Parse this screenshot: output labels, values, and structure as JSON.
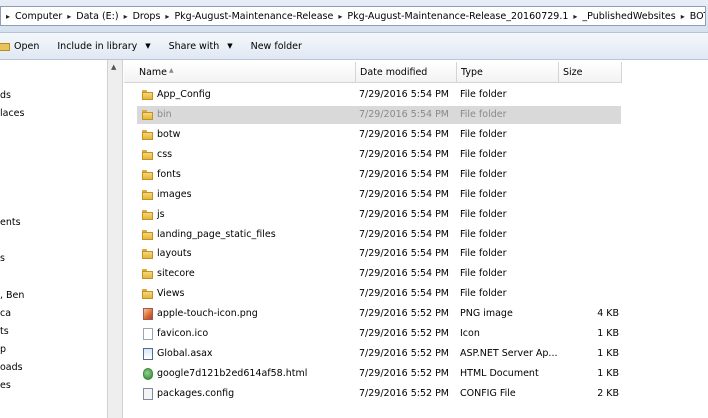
{
  "address_bar": {
    "breadcrumbs": [
      "Computer",
      "Data (E:)",
      "Drops",
      "Pkg-August-Maintenance-Release",
      "Pkg-August-Maintenance-Release_20160729.1",
      "_PublishedWebsites",
      "BOTWSitecoreWeb"
    ]
  },
  "toolbar": {
    "open_label": "Open",
    "include_label": "Include in library",
    "share_label": "Share with",
    "new_folder_label": "New folder"
  },
  "nav_pane": {
    "items": [
      "ds",
      "laces",
      "ents",
      "s",
      ", Ben",
      "ca",
      "ts",
      "p",
      "oads",
      "es"
    ]
  },
  "columns": {
    "name": "Name",
    "date": "Date modified",
    "type": "Type",
    "size": "Size"
  },
  "files": [
    {
      "name": "App_Config",
      "date": "7/29/2016 5:54 PM",
      "type": "File folder",
      "size": "",
      "icon": "folder-icon"
    },
    {
      "name": "bin",
      "date": "7/29/2016 5:54 PM",
      "type": "File folder",
      "size": "",
      "icon": "folder-icon",
      "selected": true
    },
    {
      "name": "botw",
      "date": "7/29/2016 5:54 PM",
      "type": "File folder",
      "size": "",
      "icon": "folder-icon"
    },
    {
      "name": "css",
      "date": "7/29/2016 5:54 PM",
      "type": "File folder",
      "size": "",
      "icon": "folder-icon"
    },
    {
      "name": "fonts",
      "date": "7/29/2016 5:54 PM",
      "type": "File folder",
      "size": "",
      "icon": "folder-icon"
    },
    {
      "name": "images",
      "date": "7/29/2016 5:54 PM",
      "type": "File folder",
      "size": "",
      "icon": "folder-icon"
    },
    {
      "name": "js",
      "date": "7/29/2016 5:54 PM",
      "type": "File folder",
      "size": "",
      "icon": "folder-icon"
    },
    {
      "name": "landing_page_static_files",
      "date": "7/29/2016 5:54 PM",
      "type": "File folder",
      "size": "",
      "icon": "folder-icon"
    },
    {
      "name": "layouts",
      "date": "7/29/2016 5:54 PM",
      "type": "File folder",
      "size": "",
      "icon": "folder-icon"
    },
    {
      "name": "sitecore",
      "date": "7/29/2016 5:54 PM",
      "type": "File folder",
      "size": "",
      "icon": "folder-icon"
    },
    {
      "name": "Views",
      "date": "7/29/2016 5:54 PM",
      "type": "File folder",
      "size": "",
      "icon": "folder-icon"
    },
    {
      "name": "apple-touch-icon.png",
      "date": "7/29/2016 5:52 PM",
      "type": "PNG image",
      "size": "4 KB",
      "icon": "png-file-icon"
    },
    {
      "name": "favicon.ico",
      "date": "7/29/2016 5:52 PM",
      "type": "Icon",
      "size": "1 KB",
      "icon": "ico-file-icon"
    },
    {
      "name": "Global.asax",
      "date": "7/29/2016 5:52 PM",
      "type": "ASP.NET Server Ap...",
      "size": "1 KB",
      "icon": "asax-file-icon"
    },
    {
      "name": "google7d121b2ed614af58.html",
      "date": "7/29/2016 5:52 PM",
      "type": "HTML Document",
      "size": "1 KB",
      "icon": "html-file-icon"
    },
    {
      "name": "packages.config",
      "date": "7/29/2016 5:52 PM",
      "type": "CONFIG File",
      "size": "2 KB",
      "icon": "config-file-icon"
    }
  ],
  "colors": {
    "selected_row_bg": "#d9d9d9",
    "selected_row_text": "#8a8a8a",
    "toolbar_bg": "#e0e8f3"
  }
}
